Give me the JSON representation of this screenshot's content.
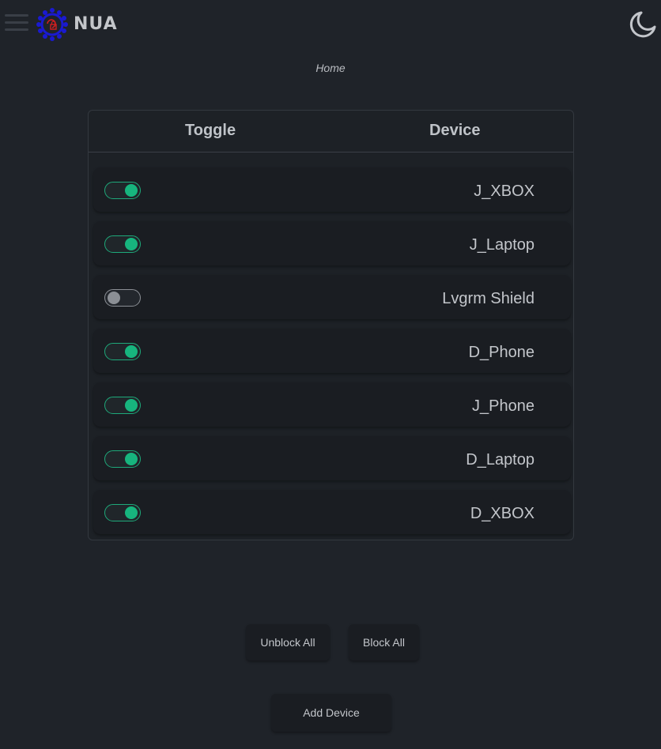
{
  "header": {
    "brand": "NUA",
    "menu_icon": "hamburger-menu-icon",
    "logo_icon": "gear-lock-logo",
    "theme_icon": "moon-icon"
  },
  "breadcrumb": "Home",
  "table": {
    "headers": [
      "Toggle",
      "Device"
    ],
    "rows": [
      {
        "device": "J_XBOX",
        "enabled": true
      },
      {
        "device": "J_Laptop",
        "enabled": true
      },
      {
        "device": "Lvgrm Shield",
        "enabled": false
      },
      {
        "device": "D_Phone",
        "enabled": true
      },
      {
        "device": "J_Phone",
        "enabled": true
      },
      {
        "device": "D_Laptop",
        "enabled": true
      },
      {
        "device": "D_XBOX",
        "enabled": true
      }
    ]
  },
  "actions": {
    "unblock_all": "Unblock All",
    "block_all": "Block All",
    "add_device": "Add Device"
  },
  "colors": {
    "background": "#1f2329",
    "toggle_on": "#17b57e",
    "toggle_off": "#8b8f95",
    "logo_blue": "#1a1ad0",
    "logo_red": "#d21f1f"
  }
}
